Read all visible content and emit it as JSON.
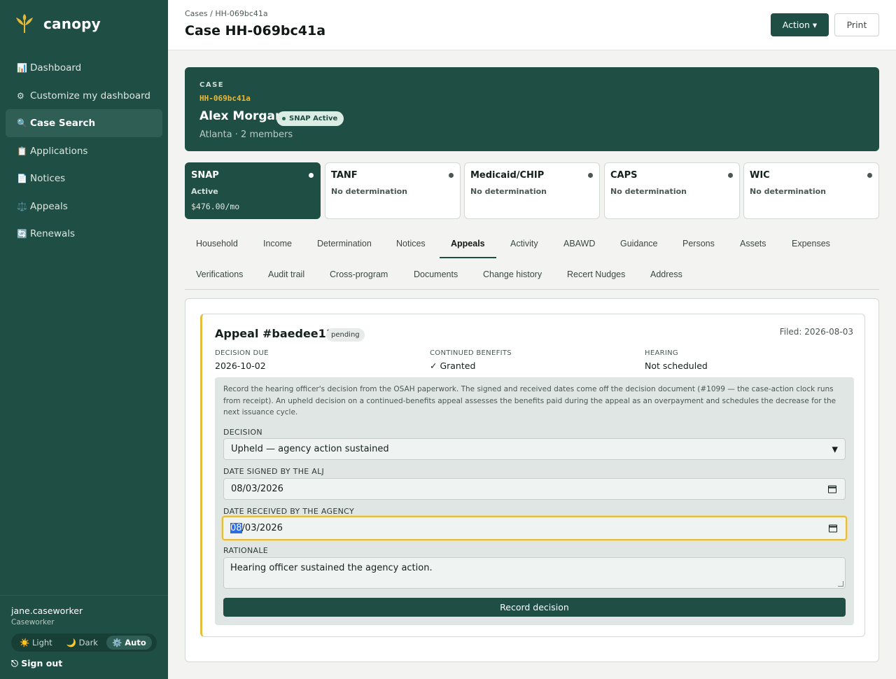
{
  "app": {
    "name": "canopy"
  },
  "sidebar": {
    "items": [
      {
        "icon": "📊",
        "label": "Dashboard"
      },
      {
        "icon": "⚙",
        "label": "Customize my dashboard"
      },
      {
        "icon": "🔍",
        "label": "Case Search",
        "active": true
      },
      {
        "icon": "📋",
        "label": "Applications"
      },
      {
        "icon": "📄",
        "label": "Notices"
      },
      {
        "icon": "⚖️",
        "label": "Appeals"
      },
      {
        "icon": "🔄",
        "label": "Renewals"
      }
    ],
    "user": {
      "name": "jane.caseworker",
      "role": "Caseworker"
    },
    "theme": {
      "light": "☀️ Light",
      "dark": "🌙 Dark",
      "auto": "⚙️ Auto",
      "selected": "Auto"
    },
    "signout": "⎋ Sign out"
  },
  "header": {
    "breadcrumb": "Cases / HH-069bc41a",
    "title": "Case HH-069bc41a",
    "action_label": "Action ▾",
    "print_label": "Print"
  },
  "case": {
    "label": "CASE",
    "id": "HH-069bc41a",
    "name": "Alex Morgan",
    "badge": "SNAP Active",
    "location": "Atlanta · 2 members"
  },
  "programs": [
    {
      "name": "SNAP",
      "status": "Active",
      "amount": "$476.00/mo",
      "active": true
    },
    {
      "name": "TANF",
      "status": "No determination"
    },
    {
      "name": "Medicaid/CHIP",
      "status": "No determination"
    },
    {
      "name": "CAPS",
      "status": "No determination"
    },
    {
      "name": "WIC",
      "status": "No determination"
    }
  ],
  "tabs": {
    "row1": [
      "Household",
      "Income",
      "Determination",
      "Notices",
      "Appeals",
      "Activity",
      "ABAWD",
      "Guidance",
      "Persons",
      "Assets",
      "Expenses"
    ],
    "row2": [
      "Verifications",
      "Audit trail",
      "Cross-program",
      "Documents",
      "Change history",
      "Recert Nudges",
      "Address"
    ],
    "active": "Appeals"
  },
  "appeal": {
    "title": "Appeal #baedee11",
    "status": "pending",
    "filed": "Filed: 2026-08-03",
    "decision_due_label": "DECISION DUE",
    "decision_due": "2026-10-02",
    "continued_label": "CONTINUED BENEFITS",
    "continued": "✓ Granted",
    "hearing_label": "HEARING",
    "hearing": "Not scheduled",
    "form": {
      "note": "Record the hearing officer's decision from the OSAH paperwork. The signed and received dates come off the decision document (#1099 — the case-action clock runs from receipt). An upheld decision on a continued-benefits appeal assesses the benefits paid during the appeal as an overpayment and schedules the decrease for the next issuance cycle.",
      "decision_label": "DECISION",
      "decision_value": "Upheld — agency action sustained",
      "signed_label": "DATE SIGNED BY THE ALJ",
      "signed_value": "08/03/2026",
      "received_label": "DATE RECEIVED BY THE AGENCY",
      "received_month": "08",
      "received_rest": "/03/2026",
      "rationale_label": "RATIONALE",
      "rationale_value": "Hearing officer sustained the agency action.",
      "submit_label": "Record decision"
    }
  }
}
